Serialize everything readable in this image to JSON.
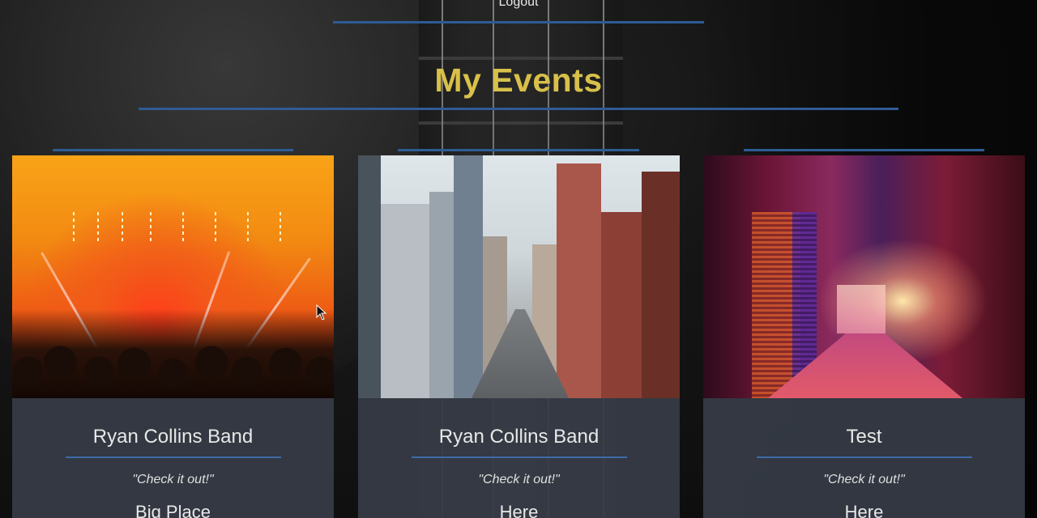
{
  "nav": {
    "logout_label": "Logout"
  },
  "page": {
    "title": "My Events"
  },
  "events": [
    {
      "name": "Ryan Collins Band",
      "tagline": "\"Check it out!\"",
      "place": "Big Place",
      "image_icon": "concert-crowd-image"
    },
    {
      "name": "Ryan Collins Band",
      "tagline": "\"Check it out!\"",
      "place": "Here",
      "image_icon": "city-street-image"
    },
    {
      "name": "Test",
      "tagline": "\"Check it out!\"",
      "place": "Here",
      "image_icon": "neon-alley-image"
    }
  ],
  "colors": {
    "title": "#d8c04a",
    "rule": "#2e5c95",
    "card_bg": "#363c46"
  }
}
